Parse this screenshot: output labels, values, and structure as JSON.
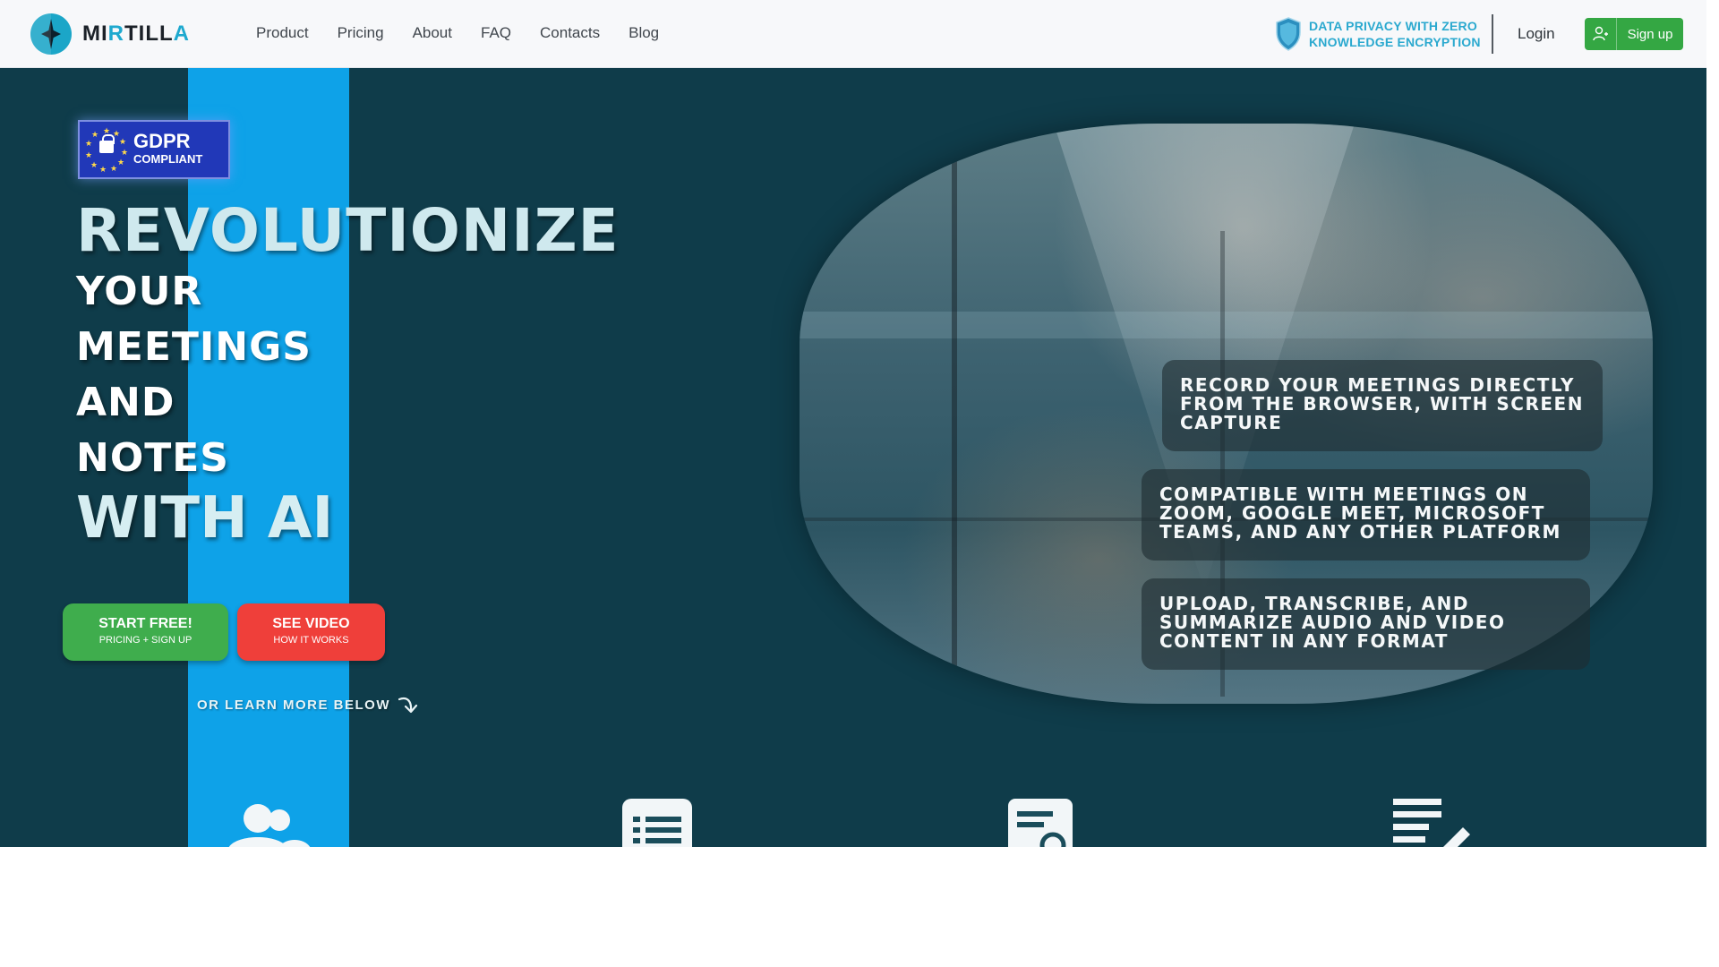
{
  "brand": {
    "name_prefix": "MI",
    "name_mid": "R",
    "name_rest": "TILL",
    "name_accent": "A",
    "full_name": "MIRTILLA"
  },
  "nav": {
    "items": [
      {
        "label": "Product"
      },
      {
        "label": "Pricing"
      },
      {
        "label": "About"
      },
      {
        "label": "FAQ"
      },
      {
        "label": "Contacts"
      },
      {
        "label": "Blog"
      }
    ],
    "privacy_line1": "DATA PRIVACY WITH ZERO",
    "privacy_line2": "KNOWLEDGE ENCRYPTION",
    "login_label": "Login",
    "signup_label": "Sign up"
  },
  "badge": {
    "title": "GDPR",
    "subtitle": "COMPLIANT"
  },
  "headline": {
    "line1": "REVOLUTIONIZE",
    "line2": "YOUR",
    "line3": "MEETINGS",
    "line4": "AND",
    "line5": "NOTES",
    "line6": "WITH AI"
  },
  "cta": {
    "start_main": "START FREE!",
    "start_sub": "PRICING + SIGN UP",
    "video_main": "SEE VIDEO",
    "video_sub": "HOW IT WORKS",
    "learn_more": "OR LEARN MORE BELOW"
  },
  "features": [
    {
      "text": "RECORD YOUR MEETINGS DIRECTLY FROM THE BROWSER, WITH SCREEN CAPTURE"
    },
    {
      "text": "COMPATIBLE WITH MEETINGS ON ZOOM, GOOGLE MEET, MICROSOFT TEAMS, AND ANY OTHER PLATFORM"
    },
    {
      "text": "UPLOAD, TRANSCRIBE, AND SUMMARIZE AUDIO AND VIDEO CONTENT IN ANY FORMAT"
    }
  ],
  "icons": {
    "logo": "star-compass-icon",
    "privacy": "shield-icon",
    "signup": "user-add-icon",
    "learn_more": "curved-arrow-down-icon",
    "section": [
      "users-icon",
      "list-icon",
      "document-search-icon",
      "edit-notes-icon"
    ]
  },
  "colors": {
    "hero_bg": "#0f3c4a",
    "stripe": "#0ea2e8",
    "accent": "#1ea9cf",
    "signup_green": "#34a743",
    "start_green": "#3fad4d",
    "video_red": "#ef3f3a",
    "gdpr_blue": "#2138b8"
  }
}
